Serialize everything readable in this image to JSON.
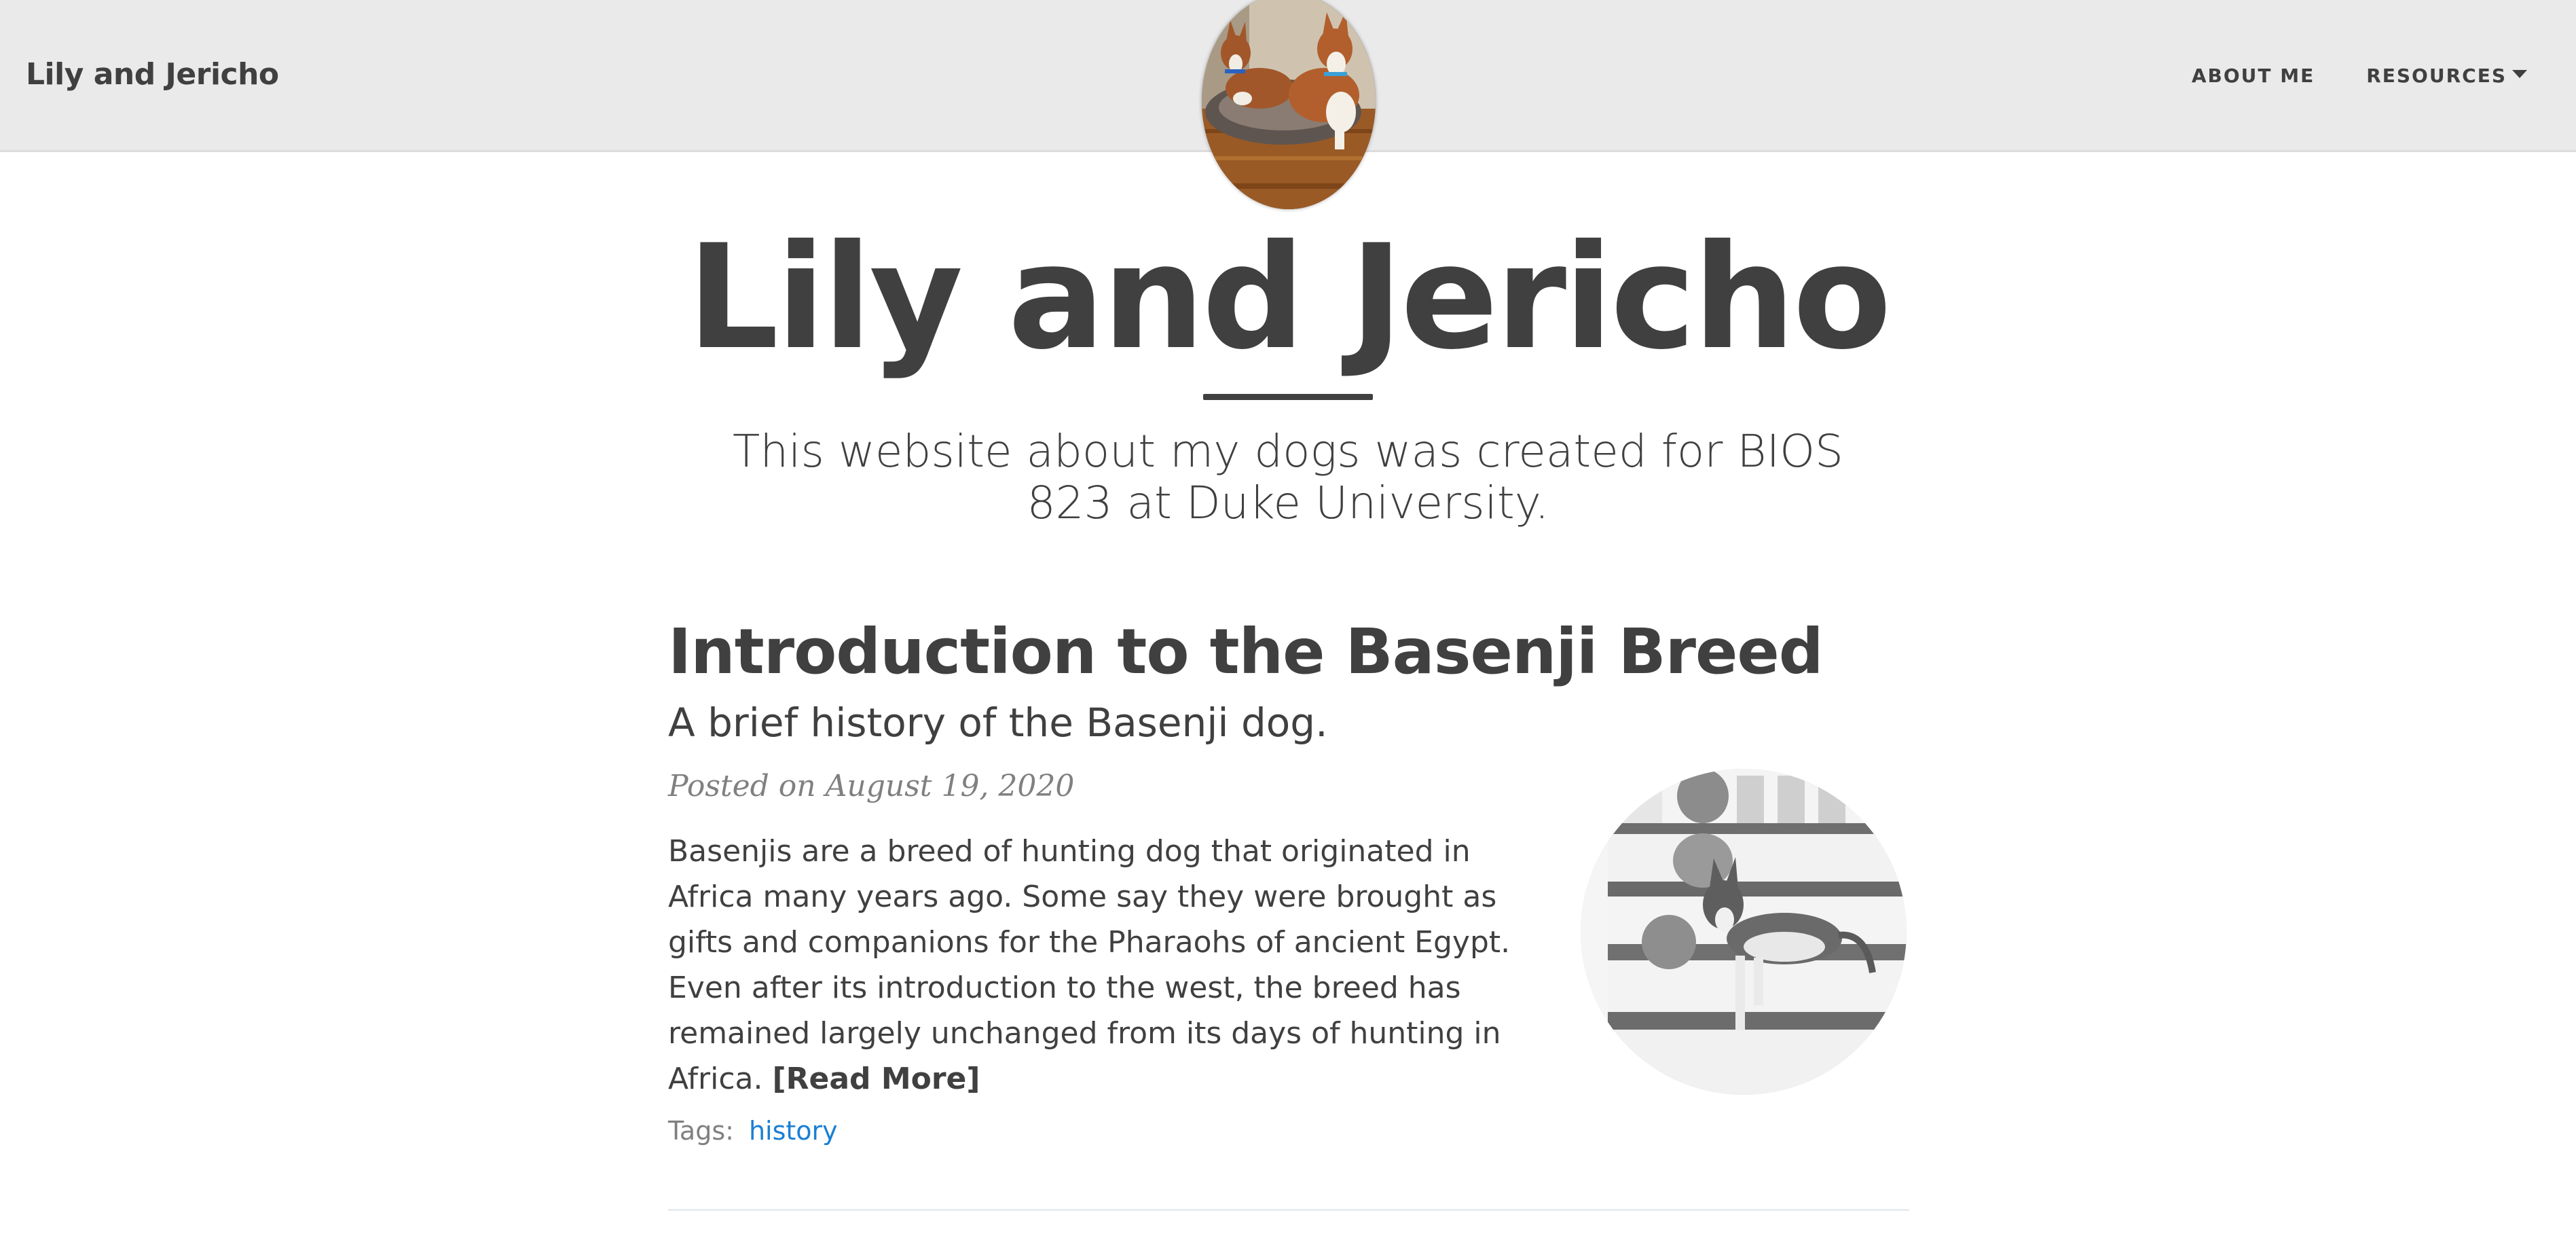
{
  "navbar": {
    "brand": "Lily and Jericho",
    "links": [
      {
        "label": "ABOUT ME"
      },
      {
        "label": "RESOURCES",
        "has_dropdown": true
      }
    ]
  },
  "icons": {
    "dropdown": "caret-down-icon"
  },
  "hero": {
    "title": "Lily and Jericho",
    "subtitle": "This website about my dogs was created for BIOS 823 at Duke University."
  },
  "post": {
    "title": "Introduction to the Basenji Breed",
    "subtitle": "A brief history of the Basenji dog.",
    "meta": "Posted on August 19, 2020",
    "excerpt": "Basenjis are a breed of hunting dog that originated in Africa many years ago. Some say they were brought as gifts and companions for the Pharaohs of ancient Egypt. Even after its introduction to the west, the breed has remained largely unchanged from its days of hunting in Africa.",
    "read_more": "[Read More]",
    "tags_label": "Tags:",
    "tags": [
      "history"
    ]
  },
  "colors": {
    "navbar_bg": "#eaeaea",
    "text": "#404040",
    "meta": "#808080",
    "link": "#1a7fd4"
  }
}
